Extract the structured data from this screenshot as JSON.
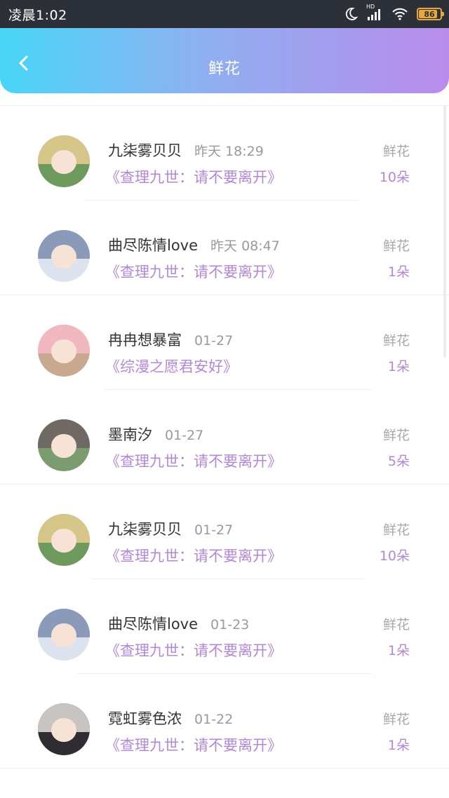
{
  "status_bar": {
    "time": "凌晨1:02",
    "network": "HD",
    "battery": "86",
    "battery_fraction": 0.86
  },
  "header": {
    "title": "鲜花",
    "back_icon": "chevron-left-icon"
  },
  "records": [
    {
      "name": "九柒雾贝贝",
      "time": "昨天 18:29",
      "book": "《查理九世：请不要离开》",
      "gift_label": "鲜花",
      "gift_count": "10朵",
      "avatar_colors": [
        "#d7c68a",
        "#6f9a5e"
      ]
    },
    {
      "name": "曲尽陈情love",
      "time": "昨天 08:47",
      "book": "《查理九世：请不要离开》",
      "gift_label": "鲜花",
      "gift_count": "1朵",
      "avatar_colors": [
        "#8a9ab8",
        "#dde3ee"
      ]
    },
    {
      "name": "冉冉想暴富",
      "time": "01-27",
      "book": "《综漫之愿君安好》",
      "gift_label": "鲜花",
      "gift_count": "1朵",
      "avatar_colors": [
        "#f2b8c0",
        "#c9a890"
      ]
    },
    {
      "name": "墨南汐",
      "time": "01-27",
      "book": "《查理九世：请不要离开》",
      "gift_label": "鲜花",
      "gift_count": "5朵",
      "avatar_colors": [
        "#6e6a63",
        "#7a9c6e"
      ]
    },
    {
      "name": "九柒雾贝贝",
      "time": "01-27",
      "book": "《查理九世：请不要离开》",
      "gift_label": "鲜花",
      "gift_count": "10朵",
      "avatar_colors": [
        "#d7c68a",
        "#6f9a5e"
      ]
    },
    {
      "name": "曲尽陈情love",
      "time": "01-23",
      "book": "《查理九世：请不要离开》",
      "gift_label": "鲜花",
      "gift_count": "1朵",
      "avatar_colors": [
        "#8a9ab8",
        "#dde3ee"
      ]
    },
    {
      "name": "霓虹雾色浓",
      "time": "01-22",
      "book": "《查理九世：请不要离开》",
      "gift_label": "鲜花",
      "gift_count": "1朵",
      "avatar_colors": [
        "#c8c4c2",
        "#2f2c33"
      ]
    }
  ]
}
